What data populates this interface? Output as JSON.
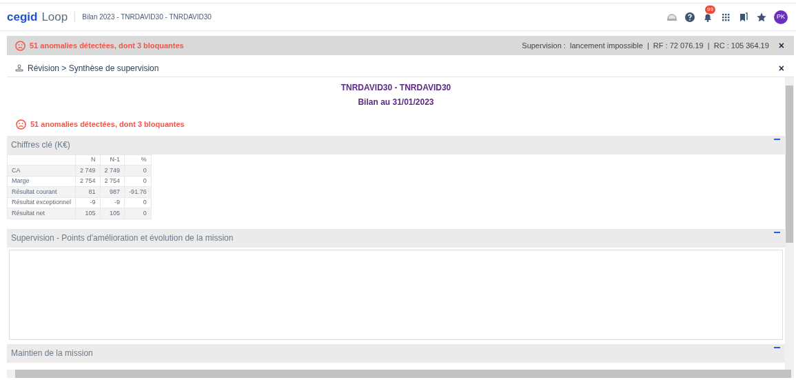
{
  "header": {
    "logo_brand": "cegid",
    "logo_product": "Loop",
    "breadcrumb": "Bilan 2023 - TNRDAVID30 - TNRDAVID30",
    "notification_count": "99",
    "avatar": "PK"
  },
  "alert_bar": {
    "message": "51 anomalies détectées, dont 3 bloquantes",
    "status": "Supervision :  lancement impossible  |  RF : 72 076.19  |  RC : 105 364.19",
    "close": "×"
  },
  "panel": {
    "title": "Révision > Synthèse de supervision",
    "close": "×",
    "company": "TNRDAVID30 - TNRDAVID30",
    "period": "Bilan au 31/01/2023",
    "anomalies": "51 anomalies détectées, dont 3 bloquantes",
    "sections": [
      {
        "kind": "table",
        "title": "Chiffres clé (K€)",
        "columns": [
          "",
          "N",
          "N-1",
          "%"
        ],
        "rows": [
          [
            "CA",
            "2 749",
            "2 749",
            "0"
          ],
          [
            "Marge",
            "2 754",
            "2 754",
            "0"
          ],
          [
            "Résultat courant",
            "81",
            "987",
            "-91.76"
          ],
          [
            "Résultat exceptionnel",
            "-9",
            "-9",
            "0"
          ],
          [
            "Résultat net",
            "105",
            "105",
            "0"
          ]
        ]
      },
      {
        "kind": "textarea",
        "title": "Supervision - Points d'amélioration et évolution de la mission"
      },
      {
        "kind": "empty",
        "title": "Maintien de la mission"
      }
    ]
  }
}
